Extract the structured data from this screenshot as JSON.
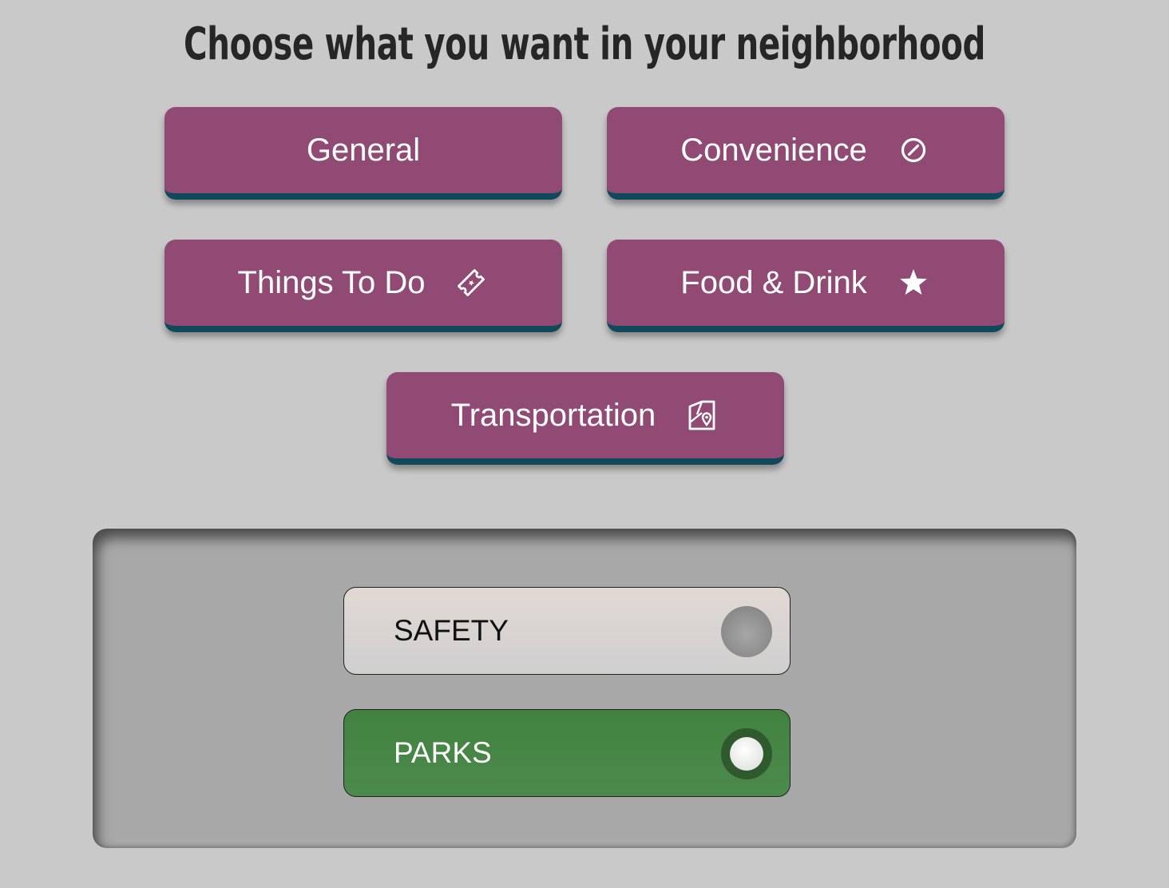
{
  "header": {
    "title": "Choose what you want in your neighborhood"
  },
  "categories": [
    {
      "label": "General",
      "icon": ""
    },
    {
      "label": "Convenience",
      "icon": "compass-icon"
    },
    {
      "label": "Things To Do",
      "icon": "ticket-icon"
    },
    {
      "label": "Food & Drink",
      "icon": "star-icon"
    },
    {
      "label": "Transportation",
      "icon": "map-pin-icon"
    }
  ],
  "toggles": [
    {
      "label": "SAFETY",
      "state": "off"
    },
    {
      "label": "PARKS",
      "state": "on"
    }
  ],
  "colors": {
    "background": "#c9c9c9",
    "button": "#914a74",
    "button_edge": "#11495c",
    "panel": "#a8a8a8",
    "toggle_on": "#4b8a4c",
    "toggle_off": "#d6d3d1"
  }
}
